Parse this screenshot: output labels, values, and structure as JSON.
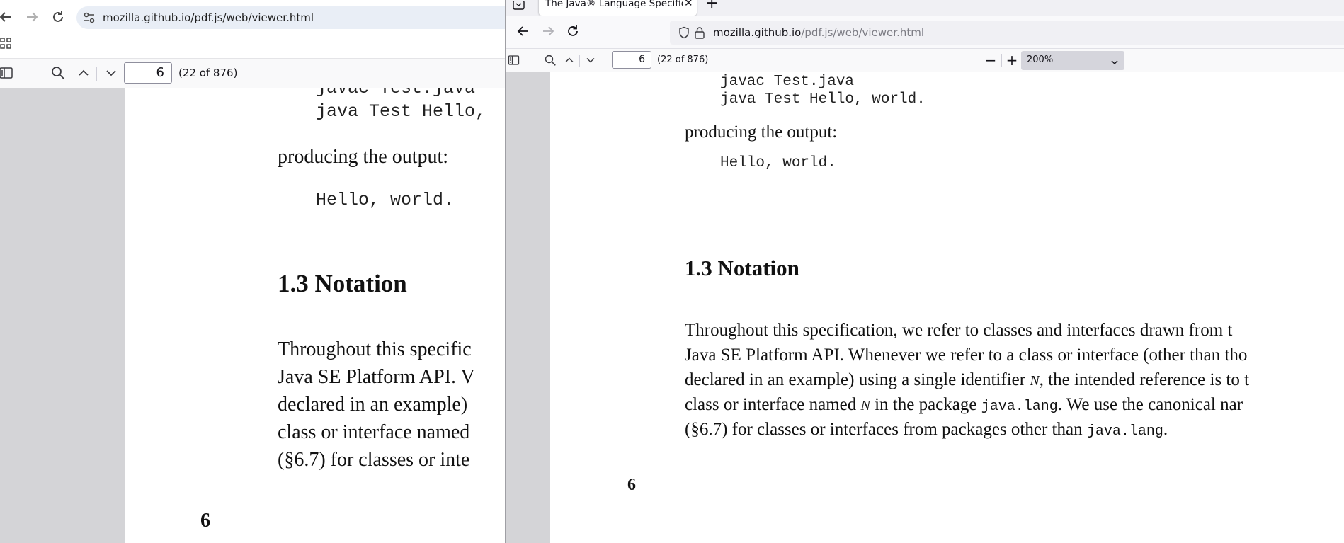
{
  "left_window": {
    "address": "mozilla.github.io/pdf.js/web/viewer.html",
    "pdf_toolbar": {
      "page_number": "6",
      "page_count": "(22 of 876)"
    },
    "page": {
      "code_top_1": "javac Test.java",
      "code_top_2": "java Test Hello,",
      "producing": "producing the output:",
      "output_code": "Hello, world.",
      "heading": "1.3   Notation",
      "para_lines": [
        "Throughout this specific",
        "Java SE Platform API. V",
        "declared in an example)",
        "class or interface named",
        "(§6.7) for classes or inte"
      ],
      "page_footer": "6"
    }
  },
  "right_window": {
    "tab_title": "The Java® Language Specification",
    "address_host": "mozilla.github.io",
    "address_path": "/pdf.js/web/viewer.html",
    "pdf_toolbar": {
      "page_number": "6",
      "page_count": "(22 of 876)",
      "zoom": "200%"
    },
    "page": {
      "code_1": "javac Test.java",
      "code_2": "java Test Hello, world.",
      "producing": "producing the output:",
      "output_code": "Hello, world.",
      "heading": "1.3   Notation",
      "para": {
        "l1": "Throughout this specification, we refer to classes and interfaces drawn from t",
        "l2": "Java SE Platform API. Whenever we refer to a class or interface (other than tho",
        "l3_a": "declared in an example) using a single identifier ",
        "l3_n": "N",
        "l3_b": ", the intended reference is to t",
        "l4_a": "class or interface named ",
        "l4_n": "N",
        "l4_b": " in the package ",
        "l4_code": "java.lang",
        "l4_c": ". We use the canonical nar",
        "l5_a": "(§6.7)  for classes or interfaces from packages other than ",
        "l5_code": "java.lang",
        "l5_b": "."
      },
      "page_footer": "6"
    }
  },
  "icons": [
    "back-icon",
    "forward-icon",
    "reload-icon",
    "site-info-icon",
    "apps-icon",
    "sidebar-toggle-icon",
    "search-icon",
    "chevron-up-icon",
    "chevron-down-icon",
    "tab-list-icon",
    "close-icon",
    "plus-icon",
    "shield-icon",
    "lock-icon",
    "minus-icon"
  ]
}
